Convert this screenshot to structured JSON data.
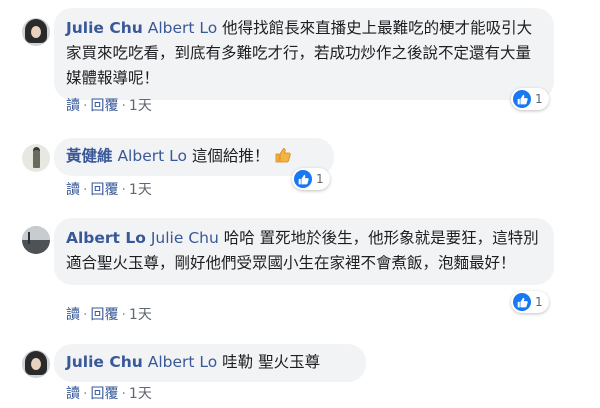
{
  "comments": [
    {
      "author": "Julie Chu",
      "tag": "Albert Lo",
      "text": "他得找館長來直播史上最難吃的梗才能吸引大家買來吃吃看，到底有多難吃才行，若成功炒作之後說不定還有大量媒體報導呢！",
      "reactions": "1",
      "reply_label": "讀",
      "reply2_label": "回覆",
      "time": "1天"
    },
    {
      "author": "黃健維",
      "tag": "Albert Lo",
      "text": "這個給推！",
      "emoji": "thumbs-up-emoji",
      "reactions": "1",
      "reply_label": "讀",
      "reply2_label": "回覆",
      "time": "1天"
    },
    {
      "author": "Albert Lo",
      "tag": "Julie Chu",
      "text": "哈哈 置死地於後生，他形象就是要狂，這特別適合聖火玉尊，剛好他們受眾國小生在家裡不會煮飯，泡麵最好！",
      "reactions": "1",
      "reply_label": "讀",
      "reply2_label": "回覆",
      "time": "1天"
    },
    {
      "author": "Julie Chu",
      "tag": "Albert Lo",
      "text": "哇勒 聖火玉尊",
      "reply_label": "讀",
      "reply2_label": "回覆",
      "time": "1天"
    }
  ],
  "colors": {
    "link": "#385898",
    "bubble": "#f2f3f5",
    "like": "#1877f2",
    "meta": "#606770"
  },
  "icons": {
    "reaction": "like-icon"
  }
}
